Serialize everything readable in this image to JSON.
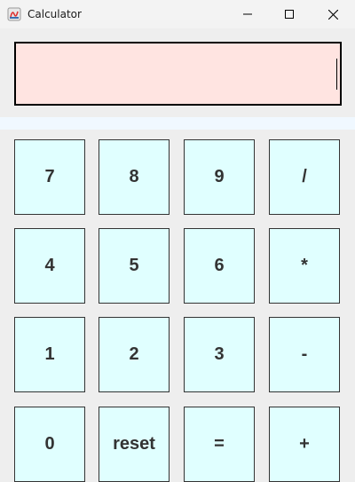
{
  "window": {
    "title": "Calculator"
  },
  "display": {
    "value": ""
  },
  "keys": {
    "k7": "7",
    "k8": "8",
    "k9": "9",
    "div": "/",
    "k4": "4",
    "k5": "5",
    "k6": "6",
    "mul": "*",
    "k1": "1",
    "k2": "2",
    "k3": "3",
    "sub": "-",
    "k0": "0",
    "reset": "reset",
    "eq": "=",
    "add": "+"
  },
  "colors": {
    "display_bg": "#ffe4e1",
    "key_bg": "#e0ffff",
    "key_text": "#333333"
  }
}
